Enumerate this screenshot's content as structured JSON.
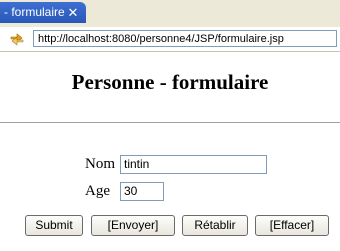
{
  "tab": {
    "title": "- formulaire",
    "close_glyph": "✕"
  },
  "address": {
    "url": "http://localhost:8080/personne4/JSP/formulaire.jsp"
  },
  "page": {
    "heading": "Personne - formulaire",
    "form": {
      "nom": {
        "label": "Nom",
        "value": "tintin"
      },
      "age": {
        "label": "Age",
        "value": "30"
      }
    },
    "buttons": {
      "submit": "Submit",
      "envoyer": "[Envoyer]",
      "retablir": "Rétablir",
      "effacer": "[Effacer]"
    }
  },
  "icons": {
    "tab_close": "close-icon",
    "nav": "arrows-icon"
  }
}
